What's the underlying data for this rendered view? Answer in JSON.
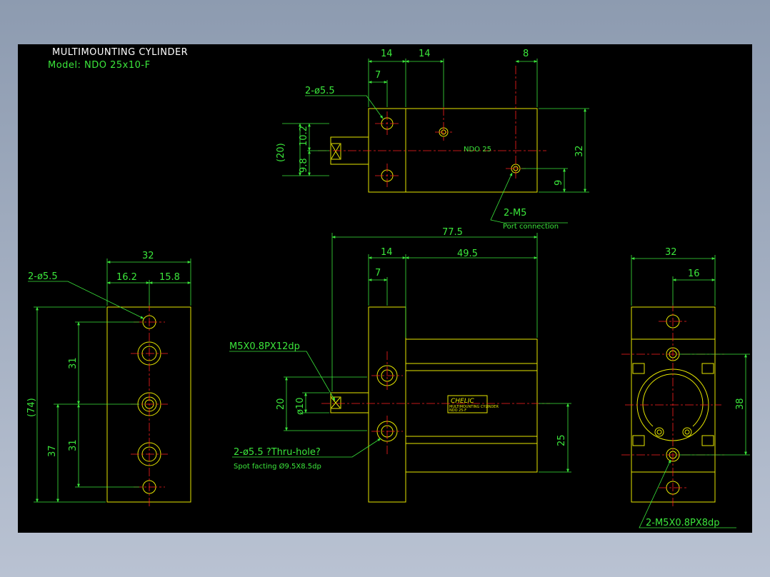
{
  "title_block": {
    "title": "MULTIMOUNTING CYLINDER",
    "model": "Model: NDO 25x10-F"
  },
  "top_view": {
    "dim_14a": "14",
    "dim_14b": "14",
    "dim_8": "8",
    "dim_7": "7",
    "dim_32": "32",
    "dim_9": "9",
    "dim_20": "(20)",
    "dim_102": "10.2",
    "dim_98": "9.8",
    "hole_note": "2-ø5.5",
    "port_note": "2-M5",
    "port_sub": "Port connection",
    "body_label": "NDO 25"
  },
  "front_view": {
    "dim_775": "77.5",
    "dim_14": "14",
    "dim_495": "49.5",
    "dim_7": "7",
    "dim_20": "20",
    "dim_10": "ø10",
    "dim_25": "25",
    "thread_note": "M5X0.8PX12dp",
    "hole_note_1": "2-ø5.5 ?Thru-hole?",
    "hole_note_2": "Spot facting  Ø9.5X8.5dp",
    "brand": "CHELIC",
    "nameplate_1": "MULTIMOUNTING CYLINDER",
    "nameplate_2": "NDO 25-F"
  },
  "left_view": {
    "dim_32": "32",
    "dim_162": "16.2",
    "dim_158": "15.8",
    "dim_74": "(74)",
    "dim_31a": "31",
    "dim_31b": "31",
    "dim_37": "37",
    "hole_note": "2-ø5.5"
  },
  "right_view": {
    "dim_32": "32",
    "dim_16": "16",
    "dim_38": "38",
    "thread_note": "2-M5X0.8PX8dp"
  },
  "colors": {
    "background": "#000000",
    "outline": "#e6e600",
    "dimension": "#3be63b",
    "center": "#ff2020",
    "title": "#ffffff"
  }
}
